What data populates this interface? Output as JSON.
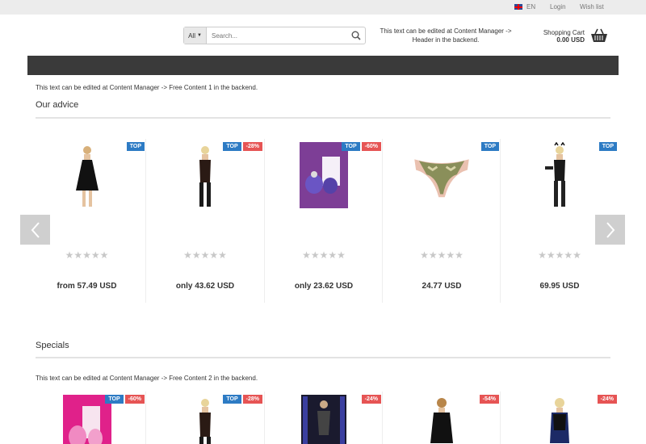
{
  "topbar": {
    "language": "EN",
    "login": "Login",
    "wishlist": "Wish list"
  },
  "search": {
    "category": "All",
    "placeholder": "Search..."
  },
  "header_note": "This text can be edited at Content Manager -> Header in the backend.",
  "cart": {
    "label": "Shopping Cart",
    "value": "0.00 USD"
  },
  "free_content_1": "This text can be edited at Content Manager -> Free Content 1 in the backend.",
  "advice": {
    "title": "Our advice",
    "products": [
      {
        "badges": [
          "TOP"
        ],
        "rating": "★★★★★",
        "price": "from 57.49 USD"
      },
      {
        "badges": [
          "TOP",
          "-28%"
        ],
        "rating": "★★★★★",
        "price": "only 43.62 USD"
      },
      {
        "badges": [
          "TOP",
          "-60%"
        ],
        "rating": "★★★★★",
        "price": "only 23.62 USD"
      },
      {
        "badges": [
          "TOP"
        ],
        "rating": "★★★★★",
        "price": "24.77 USD"
      },
      {
        "badges": [
          "TOP"
        ],
        "rating": "★★★★★",
        "price": "69.95 USD"
      }
    ]
  },
  "specials": {
    "title": "Specials",
    "free_content_2": "This text can be edited at Content Manager -> Free Content 2 in the backend.",
    "products": [
      {
        "badges": [
          "TOP",
          "-60%"
        ]
      },
      {
        "badges": [
          "TOP",
          "-28%"
        ]
      },
      {
        "badges": [
          "-24%"
        ]
      },
      {
        "badges": [
          "-54%"
        ]
      },
      {
        "badges": [
          "-24%"
        ]
      }
    ]
  },
  "colors": {
    "top_badge": "#2d7bc4",
    "discount_badge": "#e65454",
    "navbar": "#3a3a3a"
  }
}
